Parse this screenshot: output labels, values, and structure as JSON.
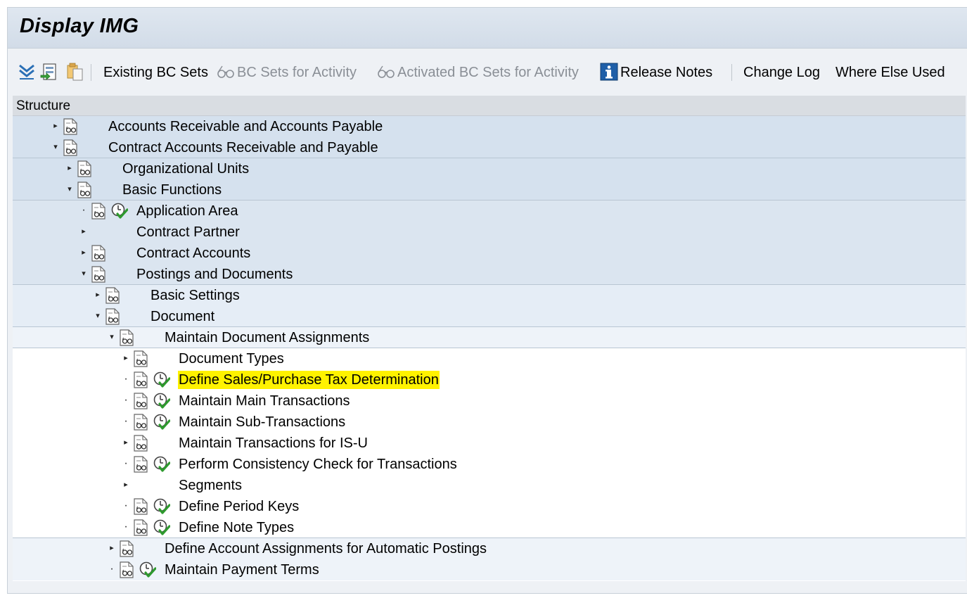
{
  "window": {
    "title": "Display IMG"
  },
  "toolbar": {
    "items": [
      {
        "label": "Existing BC Sets",
        "enabled": true
      },
      {
        "label": "BC Sets for Activity",
        "enabled": false
      },
      {
        "label": "Activated BC Sets for Activity",
        "enabled": false
      },
      {
        "label": "Release Notes",
        "enabled": true
      },
      {
        "label": "Change Log",
        "enabled": true
      },
      {
        "label": "Where Else Used",
        "enabled": true
      }
    ]
  },
  "tree": {
    "header": "Structure",
    "highlight_color": "#fff200",
    "nodes": [
      {
        "label": "Accounts Receivable and Accounts Payable",
        "level": 0,
        "expander": "collapsed",
        "doc": true,
        "activity": false
      },
      {
        "label": "Contract Accounts Receivable and Payable",
        "level": 0,
        "expander": "expanded",
        "doc": true,
        "activity": false
      },
      {
        "label": "Organizational Units",
        "level": 1,
        "expander": "collapsed",
        "doc": true,
        "activity": false
      },
      {
        "label": "Basic Functions",
        "level": 1,
        "expander": "expanded",
        "doc": true,
        "activity": false
      },
      {
        "label": "Application Area",
        "level": 2,
        "expander": "leaf",
        "doc": true,
        "activity": true
      },
      {
        "label": "Contract Partner",
        "level": 2,
        "expander": "collapsed",
        "doc": false,
        "activity": false
      },
      {
        "label": "Contract Accounts",
        "level": 2,
        "expander": "collapsed",
        "doc": true,
        "activity": false
      },
      {
        "label": "Postings and Documents",
        "level": 2,
        "expander": "expanded",
        "doc": true,
        "activity": false
      },
      {
        "label": "Basic Settings",
        "level": 3,
        "expander": "collapsed",
        "doc": true,
        "activity": false
      },
      {
        "label": "Document",
        "level": 3,
        "expander": "expanded",
        "doc": true,
        "activity": false
      },
      {
        "label": "Maintain Document Assignments",
        "level": 4,
        "expander": "expanded",
        "doc": true,
        "activity": false
      },
      {
        "label": "Document Types",
        "level": 5,
        "expander": "collapsed",
        "doc": true,
        "activity": false
      },
      {
        "label": "Define Sales/Purchase Tax Determination",
        "level": 5,
        "expander": "leaf",
        "doc": true,
        "activity": true,
        "highlighted": true
      },
      {
        "label": "Maintain Main Transactions",
        "level": 5,
        "expander": "leaf",
        "doc": true,
        "activity": true
      },
      {
        "label": "Maintain Sub-Transactions",
        "level": 5,
        "expander": "leaf",
        "doc": true,
        "activity": true
      },
      {
        "label": "Maintain Transactions for IS-U",
        "level": 5,
        "expander": "collapsed",
        "doc": true,
        "activity": false
      },
      {
        "label": "Perform Consistency Check for Transactions",
        "level": 5,
        "expander": "leaf",
        "doc": true,
        "activity": true
      },
      {
        "label": "Segments",
        "level": 5,
        "expander": "collapsed",
        "doc": false,
        "activity": false
      },
      {
        "label": "Define Period Keys",
        "level": 5,
        "expander": "leaf",
        "doc": true,
        "activity": true
      },
      {
        "label": "Define Note Types",
        "level": 5,
        "expander": "leaf",
        "doc": true,
        "activity": true
      },
      {
        "label": "Define Account Assignments for Automatic Postings",
        "level": 4,
        "expander": "collapsed",
        "doc": true,
        "activity": false
      },
      {
        "label": "Maintain Payment Terms",
        "level": 4,
        "expander": "leaf",
        "doc": true,
        "activity": true
      }
    ]
  }
}
